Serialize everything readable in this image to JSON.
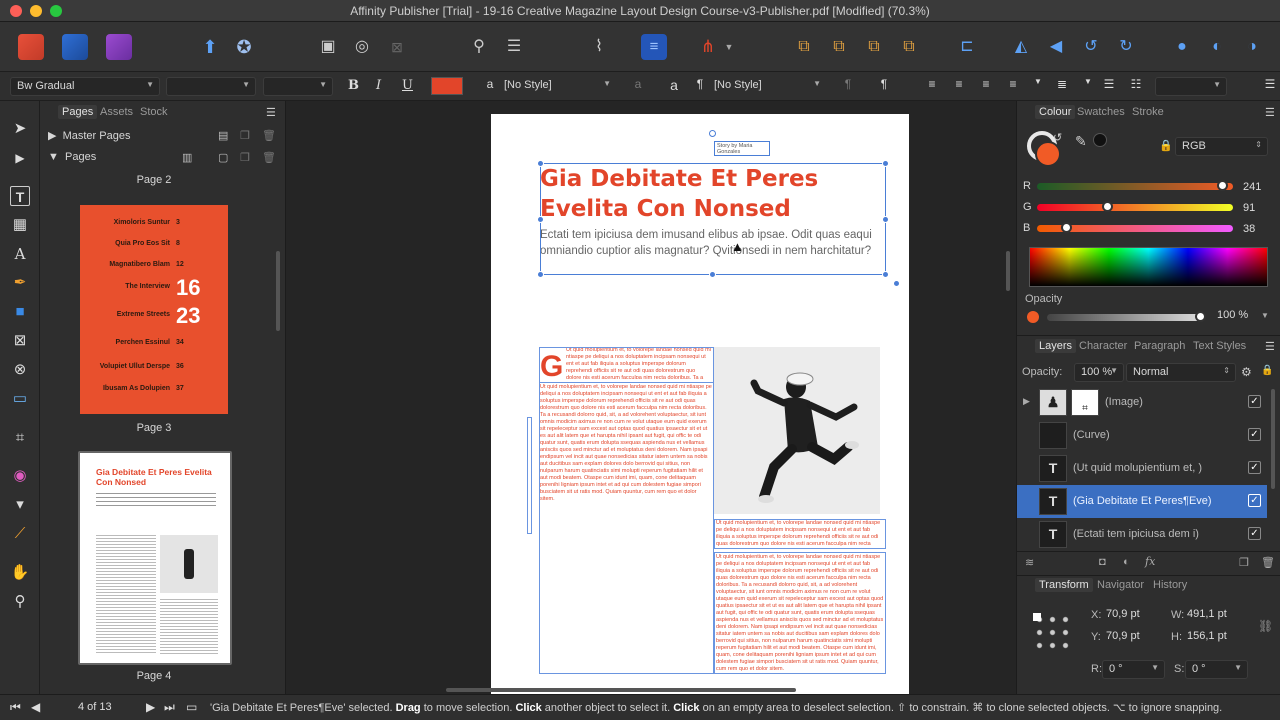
{
  "window": {
    "title": "Affinity Publisher [Trial] - 19-16 Creative Magazine Layout Design Course-v3-Publisher.pdf [Modified] (70.3%)"
  },
  "colors": {
    "accent": "#e2452a",
    "selection": "#3b6fc2",
    "close": "#fd5f57",
    "minimize": "#febc2e",
    "zoom": "#28c840"
  },
  "context_bar": {
    "font_family": "Bw Gradual",
    "font_style": "",
    "font_size": "",
    "bold": "B",
    "italic": "I",
    "underline": "U",
    "char_style": "[No Style]",
    "para_style": "[No Style]"
  },
  "pages_panel": {
    "tabs": [
      "Pages",
      "Assets",
      "Stock"
    ],
    "master_pages": "Master Pages",
    "pages": "Pages",
    "page_labels": [
      "Page 2",
      "Page 3",
      "Page 4"
    ],
    "page3_toc": [
      {
        "title": "Ximoloris Suntur",
        "num": "3"
      },
      {
        "title": "Quia Pro Eos Sit",
        "num": "8"
      },
      {
        "title": "Magnatibero Blam",
        "num": "12"
      },
      {
        "title": "The Interview",
        "num": "16"
      },
      {
        "title": "Extreme Streets",
        "num": "23"
      },
      {
        "title": "Perchen Essinul",
        "num": "34"
      },
      {
        "title": "Volupiet Ullut Derspe",
        "num": "36"
      },
      {
        "title": "Ibusam As Dolupien",
        "num": "37"
      }
    ],
    "page4_headline": "Gia Debitate Et Peres Evelita Con Nonsed"
  },
  "document": {
    "credit": "Story by Maria Gonzales",
    "headline_line1": "Gia Debitate Et Peres",
    "headline_line2": "Evelita Con Nonsed",
    "intro": "Ectati tem ipiciusa dem imusand elibus ab ipsae. Odit quas eaqui omniandio cuptior alis magnatur? Qvitionsedi in nem harchitatur?",
    "dropcap": "G",
    "body": "Ut quid molupientium et, to volorepe landae nonsed quid mi ntiaspe pe deliqui a nos doluptatem incipsam nonsequi ut ent et aut fab iliquia a soluptus imperspe dolorum reprehendi officiis sit re aut odi quas dolorestrum quo dolore nis esti acerum facculpa nim recta doloribus. Ta a recusandi dolorro quid, sit, a ad volorehent voluptaectur, sit iunt omnis modicim aximus re non cum re volut utaque eum quid exerum sit repeleceptur sam excest aut optas quod quatius ipsaectur sit et ut es aut alit latem que et harupta nihil ipsant aut fugit, qui offic te odi quatur sunt, quatis erum dolupta ssequas aspienda nus et vellamus anisciis quos sed minctur ad et moluptatus deni dolorem. Nam ipsapi endipsum vel incit aut quae nonsedicias sitatur iatem untem sa nobis aut ducitibus sam explam dolores dolo berrovid qui sitius, non nulparum harum quatinciatis simi molupti reperum fugitatiam hilit et aut modi beatem. Otaspe cum idunt imi, quam, cone delitaquam porenihi ligniam ipsum intet et ad qui cum dolestem fugiae simpori busciatem sit ut ratis mod. Quiam quuntur, cum rem quo et dolor sitem."
  },
  "right_panel": {
    "color_tabs": [
      "Colour",
      "Swatches",
      "Stroke"
    ],
    "color_model": "RGB",
    "r_label": "R",
    "g_label": "G",
    "b_label": "B",
    "r": "241",
    "g": "91",
    "b": "38",
    "r_frac": 0.945,
    "g_frac": 0.357,
    "b_frac": 0.149,
    "opacity_label": "Opacity",
    "opacity": "100 %",
    "layer_tabs": [
      "Layers",
      "Character",
      "Paragraph",
      "Text Styles"
    ],
    "layer_opacity_label": "Opacity:",
    "layer_opacity": "100 %",
    "blend_mode": "Normal",
    "layers": [
      {
        "name": "(Image)",
        "kind": "image",
        "selected": false
      },
      {
        "name": "(Curve)",
        "kind": "curve",
        "selected": false
      },
      {
        "name": "(Ut quid molupientium et, )",
        "kind": "text",
        "selected": false
      },
      {
        "name": "(Gia Debitate Et Peres¶Eve)",
        "kind": "text",
        "selected": true
      },
      {
        "name": "(Ectati tem ipiciusa dem i)",
        "kind": "text",
        "selected": false
      }
    ],
    "transform_tabs": [
      "Transform",
      "Navigator",
      "History"
    ],
    "x_label": "X:",
    "x": "70,9 pt",
    "y_label": "Y:",
    "y": "70,9 pt",
    "w_label": "W:",
    "w": "491,1 pt",
    "h_label": "H:",
    "h": "156,1 pt",
    "r_rot_label": "R:",
    "rotation": "0 °",
    "s_label": "S:",
    "shear": "0 °"
  },
  "status": {
    "page_counter": "4 of 13",
    "sel_name": "'Gia Debitate Et Peres¶Eve' selected.",
    "drag": "Drag",
    "drag_text": "to move selection.",
    "click1": "Click",
    "click1_text": "another object to select it.",
    "click2": "Click",
    "click2_text": "on an empty area to deselect selection.",
    "shift_text": "⇧ to constrain. ⌘ to clone selected objects. ⌥ to ignore snapping."
  }
}
